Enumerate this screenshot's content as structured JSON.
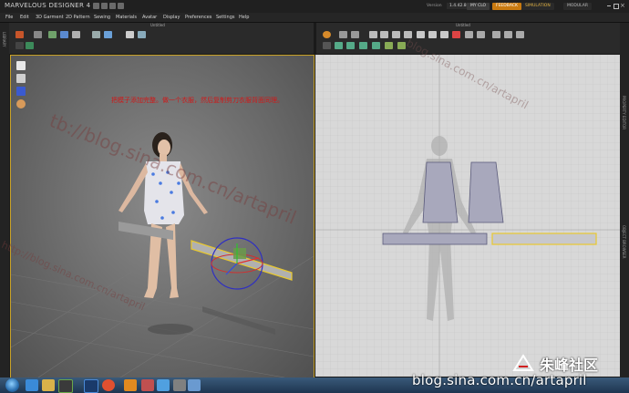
{
  "app": {
    "title": "MARVELOUS DESIGNER 4",
    "version_label": "Version",
    "version_value": "1.4.42.8690",
    "my_account": "MY CLO",
    "feedback": "FEEDBACK",
    "simulation": "SIMULATION",
    "modular": "MODULAR"
  },
  "menu": [
    "File",
    "Edit",
    "3D Garment",
    "2D Pattern",
    "Sewing",
    "Materials",
    "Avatar",
    "Display",
    "Preferences",
    "Settings",
    "Help"
  ],
  "panels": {
    "left_tab": "LIBRARY",
    "right_tab_1": "OBJECT BROWSER",
    "right_tab_2": "PROPERTY EDITOR",
    "title_3d": "Untitled",
    "title_2d": "Untitled"
  },
  "annotation": "把模子添加完整。做一个衣服，然后复制剪刀衣服背面同理。",
  "watermarks": {
    "sina_url": "blog.sina.com.cn/artapril",
    "community": "朱峰社区",
    "diag_1": "tb://blog.sina.com.cn/artapril",
    "diag_2": "blog.sina.com.cn/artapril",
    "diag_3": "http://blog.sina.com.cn/artapril"
  },
  "icons": {
    "toolbar_3d": [
      "select-icon",
      "transform-icon",
      "fold-icon",
      "fitting-suit-icon",
      "pin-icon",
      "move-icon",
      "sewing-icon",
      "tack-icon",
      "measure-icon"
    ],
    "toolbar_2d": [
      "rotate-icon",
      "transform-pattern-icon",
      "edit-point-icon",
      "add-point-icon",
      "polygon-icon",
      "rectangle-icon",
      "circle-icon",
      "internal-line-icon",
      "dart-icon",
      "segment-sewing-icon",
      "free-sewing-icon",
      "fold-arrange-icon",
      "trace-icon",
      "pin-2d-icon",
      "notch-icon",
      "zoom-icon"
    ],
    "side_3d": [
      "avatar-shirt-icon",
      "avatar-body-icon",
      "avatar-pose-icon",
      "avatar-face-icon"
    ],
    "taskbar": [
      "start-orb-icon",
      "ie-icon",
      "explorer-icon",
      "nvidia-icon",
      "photoshop-icon",
      "chrome-icon",
      "marvelous-icon",
      "app-icon",
      "qq-icon",
      "media-icon",
      "picture-icon"
    ]
  },
  "colors": {
    "selection": "#e8c830",
    "pattern_fill": "#a8a8bc",
    "pattern_line": "#5a5a7a",
    "feedback": "#c97a10",
    "annotation": "#d01818"
  }
}
